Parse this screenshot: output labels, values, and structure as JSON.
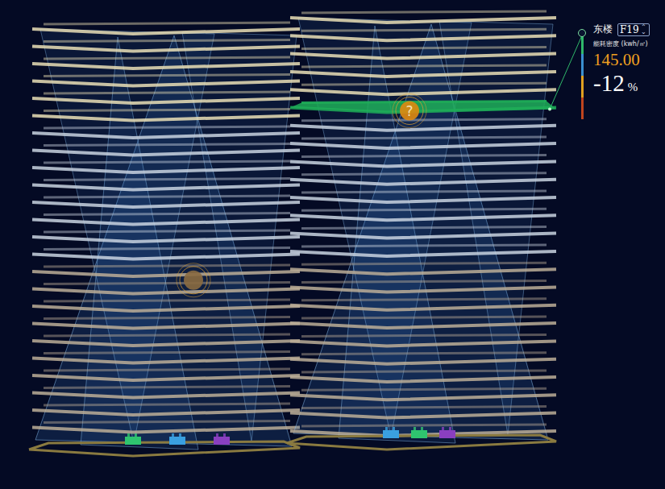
{
  "panel": {
    "building": "东楼",
    "floor": "F19",
    "stepper_icon": "⌃⌄",
    "metric_label": "能耗密度",
    "metric_unit": "(kwh/㎡)",
    "value": "145.00",
    "change": "-12",
    "change_unit": "%"
  },
  "scale": {
    "level": 1,
    "segments": [
      {
        "color": "#2fb86a"
      },
      {
        "color": "#3a8fd0"
      },
      {
        "color": "#e0a020"
      },
      {
        "color": "#c0451e"
      }
    ]
  },
  "buildings": [
    {
      "floor_count": 24,
      "highlighted_floor": -1,
      "marker": {
        "label": "",
        "kind": "pin"
      },
      "equipment": [
        {
          "color": "#2fc46f"
        },
        {
          "color": "#3aa0e0"
        },
        {
          "color": "#8a3fc0"
        }
      ]
    },
    {
      "floor_count": 24,
      "highlighted_floor": 5,
      "marker": {
        "label": "?",
        "kind": "question"
      },
      "equipment": [
        {
          "color": "#3aa0e0"
        },
        {
          "color": "#2fc46f"
        },
        {
          "color": "#8a3fc0"
        }
      ]
    }
  ]
}
